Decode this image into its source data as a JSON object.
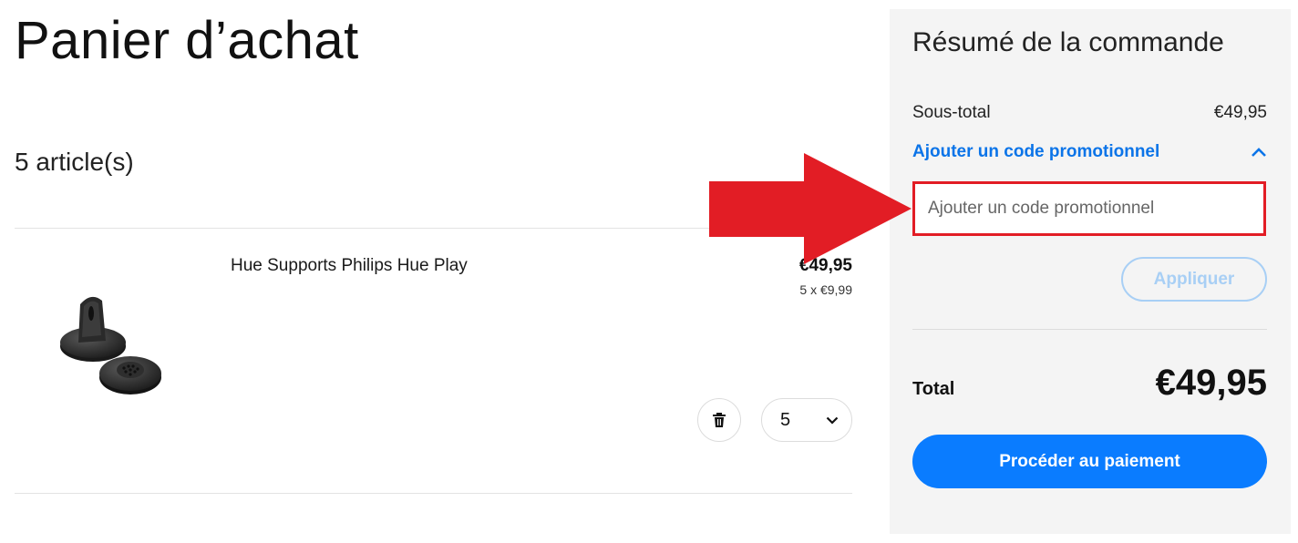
{
  "page": {
    "title": "Panier d’achat",
    "item_count": "5 article(s)"
  },
  "cart": {
    "items": [
      {
        "name": "Hue Supports Philips Hue Play",
        "price": "€49,95",
        "unit_price": "5 x €9,99",
        "quantity": "5",
        "delete_icon": "trash-icon"
      }
    ]
  },
  "summary": {
    "title": "Résumé de la commande",
    "subtotal_label": "Sous-total",
    "subtotal_value": "€49,95",
    "promo_toggle_label": "Ajouter un code promotionnel",
    "promo_placeholder": "Ajouter un code promotionnel",
    "promo_value": "",
    "apply_label": "Appliquer",
    "total_label": "Total",
    "total_value": "€49,95",
    "checkout_label": "Procéder au paiement"
  },
  "colors": {
    "accent": "#0a7cff",
    "link": "#0b74e8",
    "apply_disabled": "#a8cff5",
    "annotation": "#e21d25",
    "summary_background": "#f4f4f4"
  }
}
